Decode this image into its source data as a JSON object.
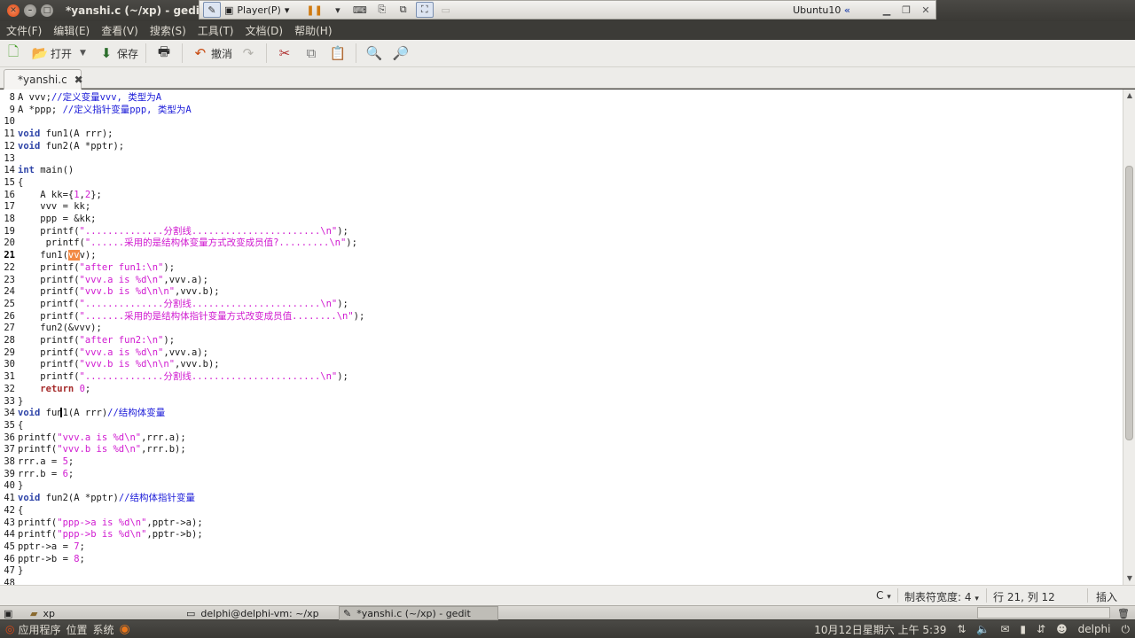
{
  "window": {
    "title": "*yanshi.c (~/xp) - gedit"
  },
  "vm_toolbar": {
    "player_label": "Player(P)",
    "guest_name": "Ubuntu10"
  },
  "menu": [
    "文件(F)",
    "编辑(E)",
    "查看(V)",
    "搜索(S)",
    "工具(T)",
    "文档(D)",
    "帮助(H)"
  ],
  "toolbar": {
    "open_label": "打开",
    "save_label": "保存",
    "undo_label": "撤消"
  },
  "tab": {
    "label": "*yanshi.c"
  },
  "code": {
    "current_line": 21,
    "lines": [
      {
        "n": 8,
        "t": "A vvv;//定义变量vvv, 类型为A"
      },
      {
        "n": 9,
        "t": "A *ppp; //定义指针变量ppp, 类型为A"
      },
      {
        "n": 10,
        "t": ""
      },
      {
        "n": 11,
        "t": "void fun1(A rrr);"
      },
      {
        "n": 12,
        "t": "void fun2(A *pptr);"
      },
      {
        "n": 13,
        "t": ""
      },
      {
        "n": 14,
        "t": "int main()"
      },
      {
        "n": 15,
        "t": "{"
      },
      {
        "n": 16,
        "t": "    A kk={1,2};"
      },
      {
        "n": 17,
        "t": "    vvv = kk;"
      },
      {
        "n": 18,
        "t": "    ppp = &kk;"
      },
      {
        "n": 19,
        "t": "    printf(\"..............分割线.......................\\n\");"
      },
      {
        "n": 20,
        "t": "     printf(\"......采用的是结构体变量方式改变成员值?.........\\n\");"
      },
      {
        "n": 21,
        "t": "    fun1(vvv);"
      },
      {
        "n": 22,
        "t": "    printf(\"after fun1:\\n\");"
      },
      {
        "n": 23,
        "t": "    printf(\"vvv.a is %d\\n\",vvv.a);"
      },
      {
        "n": 24,
        "t": "    printf(\"vvv.b is %d\\n\\n\",vvv.b);"
      },
      {
        "n": 25,
        "t": "    printf(\"..............分割线.......................\\n\");"
      },
      {
        "n": 26,
        "t": "    printf(\".......采用的是结构体指针变量方式改变成员值........\\n\");"
      },
      {
        "n": 27,
        "t": "    fun2(&vvv);"
      },
      {
        "n": 28,
        "t": "    printf(\"after fun2:\\n\");"
      },
      {
        "n": 29,
        "t": "    printf(\"vvv.a is %d\\n\",vvv.a);"
      },
      {
        "n": 30,
        "t": "    printf(\"vvv.b is %d\\n\\n\",vvv.b);"
      },
      {
        "n": 31,
        "t": "    printf(\"..............分割线.......................\\n\");"
      },
      {
        "n": 32,
        "t": "    return 0;"
      },
      {
        "n": 33,
        "t": "}"
      },
      {
        "n": 34,
        "t": "void fun1(A rrr)//结构体变量"
      },
      {
        "n": 35,
        "t": "{"
      },
      {
        "n": 36,
        "t": "printf(\"vvv.a is %d\\n\",rrr.a);"
      },
      {
        "n": 37,
        "t": "printf(\"vvv.b is %d\\n\",rrr.b);"
      },
      {
        "n": 38,
        "t": "rrr.a = 5;"
      },
      {
        "n": 39,
        "t": "rrr.b = 6;"
      },
      {
        "n": 40,
        "t": "}"
      },
      {
        "n": 41,
        "t": "void fun2(A *pptr)//结构体指针变量"
      },
      {
        "n": 42,
        "t": "{"
      },
      {
        "n": 43,
        "t": "printf(\"ppp->a is %d\\n\",pptr->a);"
      },
      {
        "n": 44,
        "t": "printf(\"ppp->b is %d\\n\",pptr->b);"
      },
      {
        "n": 45,
        "t": "pptr->a = 7;"
      },
      {
        "n": 46,
        "t": "pptr->b = 8;"
      },
      {
        "n": 47,
        "t": "}"
      },
      {
        "n": 48,
        "t": ""
      }
    ]
  },
  "statusbar": {
    "language": "C",
    "tab_width": "制表符宽度: 4",
    "position": "行 21, 列 12",
    "mode": "插入"
  },
  "taskbar": {
    "items": [
      {
        "label": "xp"
      },
      {
        "label": "delphi@delphi-vm: ~/xp"
      },
      {
        "label": "*yanshi.c (~/xp) - gedit"
      }
    ]
  },
  "panel": {
    "menu_apps": "应用程序",
    "menu_places": "位置",
    "menu_system": "系统",
    "clock": "10月12日星期六 上午 5:39",
    "user": "delphi"
  },
  "colors": {
    "accent": "#dd4814",
    "highlight": "#f28a45",
    "keyword": "#a52a2a",
    "string": "#d01ad0",
    "comment": "#1b1bd8"
  }
}
